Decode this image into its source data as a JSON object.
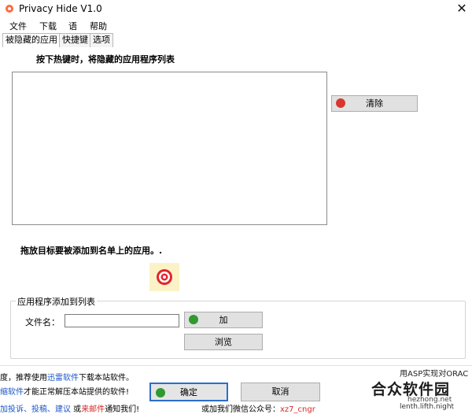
{
  "window": {
    "title": "Privacy Hide V1.0",
    "close_label": "✕"
  },
  "menu": [
    "文件",
    "下载",
    "语",
    "帮助"
  ],
  "tabs": [
    "被隐藏的应用",
    "快捷键",
    "选项"
  ],
  "list_heading": "按下热键时，将隐藏的应用程序列表",
  "clear_button": "清除",
  "drag_text": "拖放目标要被添加到名单上的应用。.",
  "group": {
    "legend": "应用程序添加到列表",
    "filename_label": "文件名：",
    "filename_value": "",
    "add_button": "加",
    "browse_button": "浏览"
  },
  "buttons": {
    "ok": "确定",
    "cancel": "取消"
  },
  "footer": {
    "line1_a": "度，推荐使用",
    "line1_link": "迅雷软件",
    "line1_b": "下载本站软件。",
    "line2_link": "缩软件",
    "line2_b": "才能正常解压本站提供的软件!",
    "line3_link1": "加投诉、投稿、建议",
    "line3_b": " 或",
    "line3_red": "来邮件",
    "line3_c": "通知我们!",
    "line3_d": "或加我们微信公众号：",
    "line3_wx": "xz7_cngr"
  },
  "watermark": {
    "right_line1": "用ASP实现对ORAC",
    "brand": "合众软件园",
    "domain": "hezhong.net",
    "right_line2": "lenth.lifth.night"
  },
  "colors": {
    "clear_icon": "#d9362f",
    "add_icon": "#2f9a2f",
    "target": "#e0262c",
    "target_bg": "#fbf3c7"
  }
}
